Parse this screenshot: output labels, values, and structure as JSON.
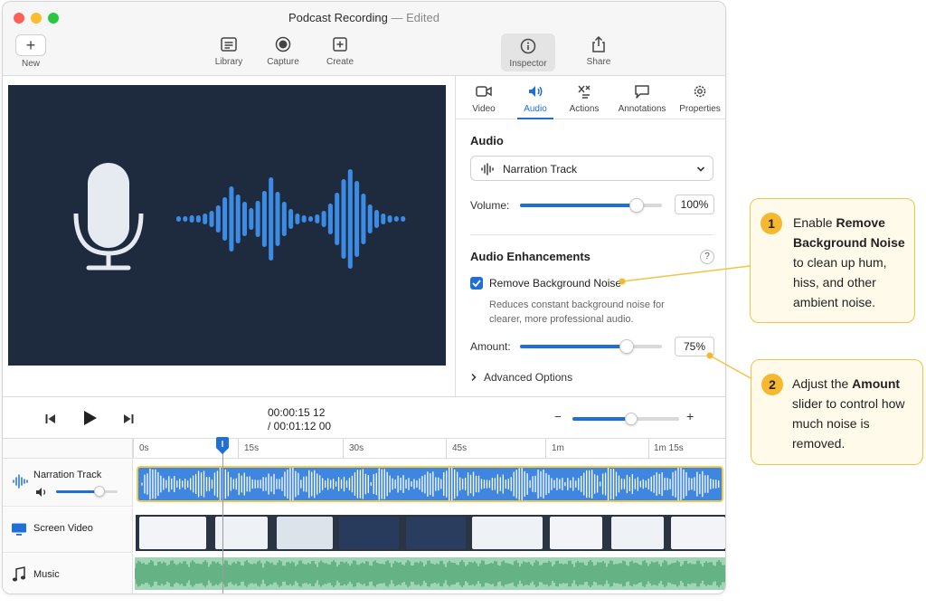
{
  "window": {
    "title": "Podcast Recording",
    "title_status": "— Edited"
  },
  "toolbar": {
    "new_label": "New",
    "library_label": "Library",
    "capture_label": "Capture",
    "create_label": "Create",
    "inspector_label": "Inspector",
    "share_label": "Share"
  },
  "inspector": {
    "tabs": [
      {
        "label": "Video",
        "icon": "video-icon"
      },
      {
        "label": "Audio",
        "icon": "speaker-icon",
        "active": true
      },
      {
        "label": "Actions",
        "icon": "actions-icon"
      },
      {
        "label": "Annotations",
        "icon": "annotation-icon"
      },
      {
        "label": "Properties",
        "icon": "gear-icon"
      }
    ],
    "audio_title": "Audio",
    "track_select": "Narration Track",
    "volume_label": "Volume:",
    "volume_value": "100%",
    "volume_level": 0.82,
    "enhancements_title": "Audio Enhancements",
    "help_label": "?",
    "remove_noise_label": "Remove Background Noise",
    "remove_noise_checked": true,
    "remove_noise_desc": "Reduces constant background noise for clearer, more professional audio.",
    "amount_label": "Amount:",
    "amount_value": "75%",
    "amount_level": 0.75,
    "advanced_label": "Advanced Options"
  },
  "transport": {
    "current_time": "00:00:15 12",
    "total_time": "/ 00:01:12 00",
    "zoom_minus": "−",
    "zoom_plus": "+",
    "zoom_level": 0.55
  },
  "timeline": {
    "ticks": [
      "0s",
      "15s",
      "30s",
      "45s",
      "1m",
      "1m 15s"
    ],
    "tracks": [
      {
        "name": "Narration Track",
        "icon": "waveform-icon"
      },
      {
        "name": "Screen Video",
        "icon": "monitor-icon"
      },
      {
        "name": "Music",
        "icon": "music-note-icon"
      }
    ],
    "narration_volume_level": 0.7
  },
  "callouts": [
    {
      "number": "1",
      "pre": "Enable ",
      "bold": "Remove Background Noise",
      "post": " to clean up hum, hiss, and other ambient noise."
    },
    {
      "number": "2",
      "pre": "Adjust the ",
      "bold": "Amount",
      "post": " slider to control how much noise is removed."
    }
  ],
  "colors": {
    "accent": "#1f6fd6",
    "callout_bg": "#fffaea",
    "callout_border": "#f0c447",
    "preview_bg": "#1e2b3e",
    "narration_clip": "#3e86e0",
    "music_clip": "#9fd4b4"
  }
}
